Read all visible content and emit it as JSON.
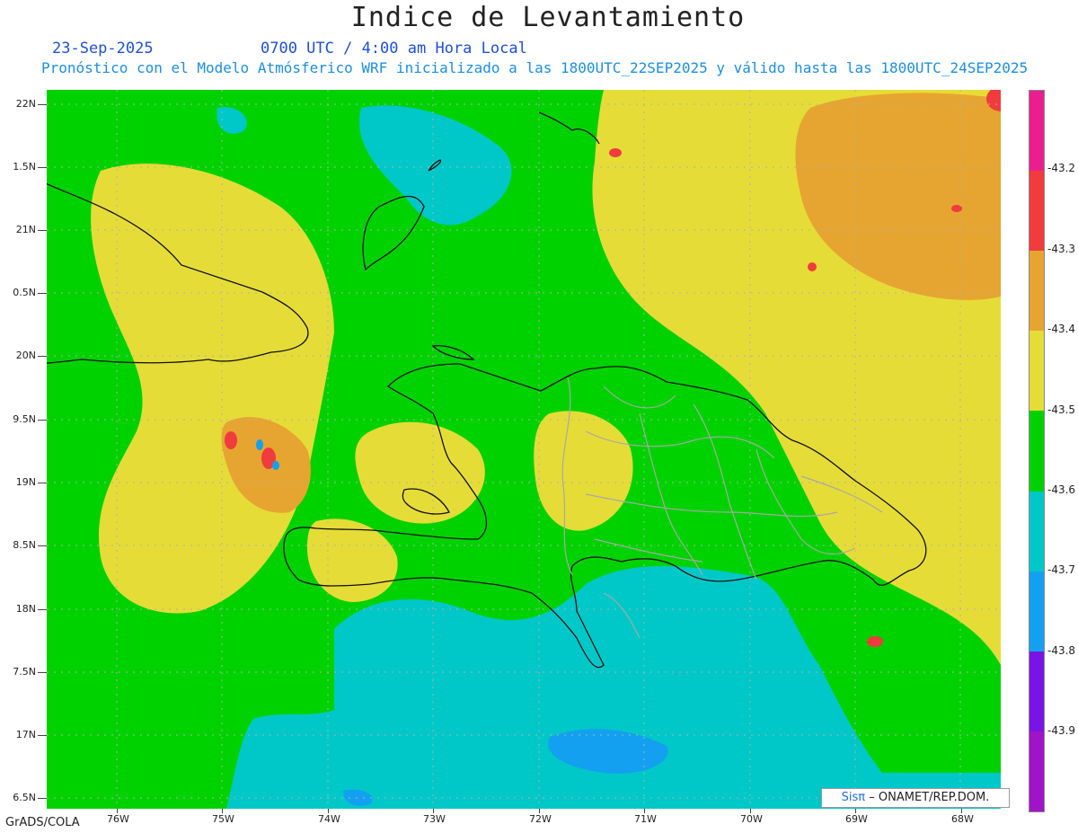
{
  "title": "Indice de Levantamiento",
  "date": "23-Sep-2025",
  "time": "0700 UTC / 4:00 am Hora Local",
  "forecast": "Pronóstico con el Modelo Atmósferico WRF inicializado a las 1800UTC_22SEP2025 y válido hasta las  1800UTC_24SEP2025",
  "lat_labels": [
    "22N",
    "1.5N",
    "21N",
    "0.5N",
    "20N",
    "9.5N",
    "19N",
    "8.5N",
    "18N",
    "7.5N",
    "17N",
    "6.5N"
  ],
  "lon_labels": [
    "76W",
    "75W",
    "74W",
    "73W",
    "72W",
    "71W",
    "70W",
    "69W",
    "68W"
  ],
  "colorbar": {
    "labels": [
      "-43.2",
      "-43.3",
      "-43.4",
      "-43.5",
      "-43.6",
      "-43.7",
      "-43.8",
      "-43.9"
    ],
    "colors": [
      "#ea1e8f",
      "#f03c3c",
      "#e6a530",
      "#e6dc37",
      "#00d200",
      "#00c8c8",
      "#14a0f0",
      "#7a14e6",
      "#a014c8"
    ]
  },
  "map_colors": {
    "green": "#00d200",
    "yellow": "#e6dc37",
    "orange": "#e6a530",
    "red": "#f03c3c",
    "cyan": "#00c8c8",
    "blue": "#14a0f0"
  },
  "credit": {
    "brand": "Sisπ",
    "org": "– ONAMET/REP.DOM."
  },
  "footer": "GrADS/COLA"
}
